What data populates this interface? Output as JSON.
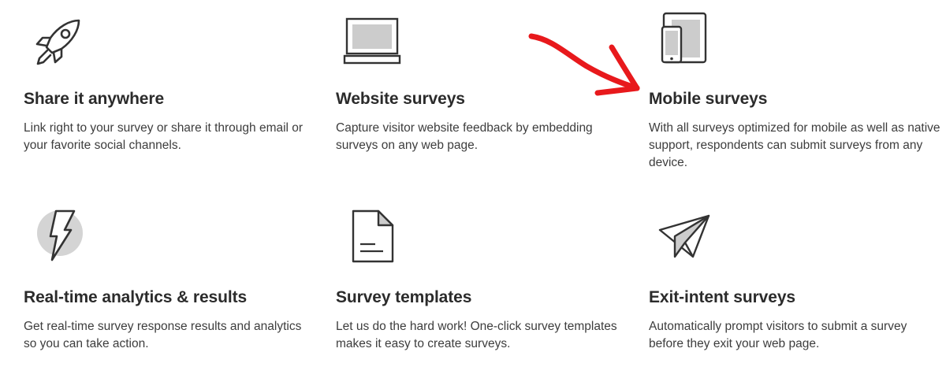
{
  "features": [
    {
      "title": "Share it anywhere",
      "description": "Link right to your survey or share it through email or your favorite social channels.",
      "icon": "rocket-icon"
    },
    {
      "title": "Website surveys",
      "description": "Capture visitor website feedback by embedding surveys on any web page.",
      "icon": "laptop-icon"
    },
    {
      "title": "Mobile surveys",
      "description": "With all surveys optimized for mobile as well as native support, respondents can submit surveys from any device.",
      "icon": "mobile-devices-icon"
    },
    {
      "title": "Real-time analytics & results",
      "description": "Get real-time survey response results and analytics so you can take action.",
      "icon": "lightning-bolt-icon"
    },
    {
      "title": "Survey templates",
      "description": "Let us do the hard work! One-click survey templates makes it easy to create surveys.",
      "icon": "document-icon"
    },
    {
      "title": "Exit-intent surveys",
      "description": "Automatically prompt visitors to submit a survey before they exit your web page.",
      "icon": "paper-plane-icon"
    }
  ],
  "annotation": {
    "icon": "red-arrow-icon",
    "color": "#e8191c"
  },
  "colors": {
    "icon_stroke": "#333333",
    "icon_fill": "#cccccc",
    "title": "#2b2b2b",
    "text": "#3d3d3d"
  }
}
